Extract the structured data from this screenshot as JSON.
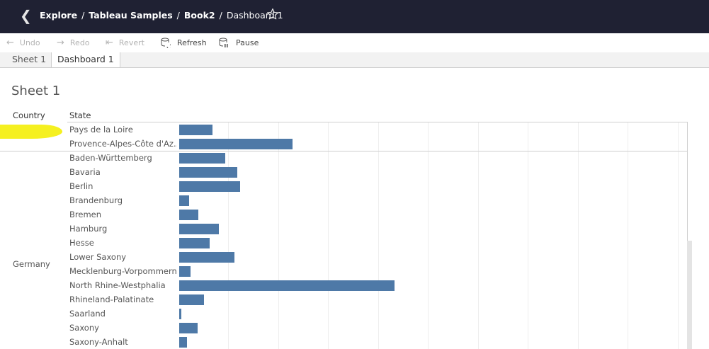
{
  "nav": {
    "crumbs": [
      "Explore",
      "Tableau Samples",
      "Book2",
      "Dashboard 1"
    ],
    "separator": "/"
  },
  "toolbar": {
    "undo": "Undo",
    "redo": "Redo",
    "revert": "Revert",
    "refresh": "Refresh",
    "pause": "Pause"
  },
  "tabs": [
    "Sheet 1",
    "Dashboard 1"
  ],
  "sheet": {
    "title": "Sheet 1",
    "col_country": "Country",
    "col_state": "State",
    "country_germany": "Germany"
  },
  "rows": [
    {
      "state": "Pays de la Loire",
      "value": 47
    },
    {
      "state": "Provence-Alpes-Côte d'Az..",
      "value": 160
    },
    {
      "state": "Baden-Württemberg",
      "value": 65
    },
    {
      "state": "Bavaria",
      "value": 82
    },
    {
      "state": "Berlin",
      "value": 86
    },
    {
      "state": "Brandenburg",
      "value": 14
    },
    {
      "state": "Bremen",
      "value": 27
    },
    {
      "state": "Hamburg",
      "value": 56
    },
    {
      "state": "Hesse",
      "value": 43
    },
    {
      "state": "Lower Saxony",
      "value": 78
    },
    {
      "state": "Mecklenburg-Vorpommern",
      "value": 16
    },
    {
      "state": "North Rhine-Westphalia",
      "value": 304
    },
    {
      "state": "Rhineland-Palatinate",
      "value": 35
    },
    {
      "state": "Saarland",
      "value": 3
    },
    {
      "state": "Saxony",
      "value": 26
    },
    {
      "state": "Saxony-Anhalt",
      "value": 11
    }
  ],
  "colors": {
    "bar": "#4e79a7",
    "topbar": "#1f2133",
    "highlight": "#f5f020"
  }
}
